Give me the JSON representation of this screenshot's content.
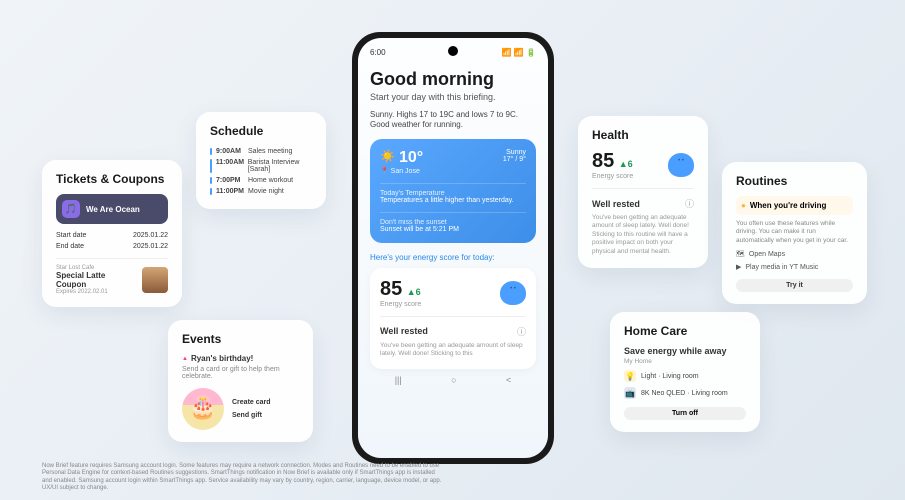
{
  "tickets": {
    "title": "Tickets & Coupons",
    "ticket_name": "We Are Ocean",
    "start_label": "Start date",
    "start_val": "2025.01.22",
    "end_label": "End date",
    "end_val": "2025.01.22",
    "coupon_vendor": "Star Lost Cafe",
    "coupon_name": "Special Latte Coupon",
    "coupon_exp": "Expires 2022.02.01"
  },
  "schedule": {
    "title": "Schedule",
    "items": [
      {
        "time": "9:00AM",
        "text": "Sales meeting"
      },
      {
        "time": "11:00AM",
        "text": "Barista Interview [Sarah]"
      },
      {
        "time": "7:00PM",
        "text": "Home workout"
      },
      {
        "time": "11:00PM",
        "text": "Movie night"
      }
    ]
  },
  "events": {
    "title": "Events",
    "headline": "Ryan's birthday!",
    "sub": "Send a card or gift to help them celebrate.",
    "btn1": "Create card",
    "btn2": "Send gift"
  },
  "phone": {
    "time": "6:00",
    "status_icons": "📶 📶 🔋",
    "greeting": "Good morning",
    "greeting_sub": "Start your day with this briefing.",
    "weather_summary": "Sunny. Highs 17 to 19C and lows 7 to 9C. Good weather for running.",
    "weather": {
      "temp": "10°",
      "loc": "📍 San Jose",
      "cond": "Sunny",
      "range": "17° / 9°",
      "sec1_h": "Today's Temperature",
      "sec1_v": "Temperatures a little higher than yesterday.",
      "sec2_h": "Don't miss the sunset",
      "sec2_v": "Sunset will be at 5:21 PM"
    },
    "energy_intro_a": "Here's your ",
    "energy_intro_b": "energy score",
    "energy_intro_c": " for today:",
    "energy": {
      "score": "85",
      "change": "▲6",
      "sub": "Energy score",
      "well": "Well rested",
      "info": "ⓘ",
      "desc": "You've been getting an adequate amount of sleep lately. Well done! Sticking to this"
    }
  },
  "health": {
    "title": "Health",
    "score": "85",
    "change": "▲6",
    "sub": "Energy score",
    "well": "Well rested",
    "info": "ⓘ",
    "desc": "You've been getting an adequate amount of sleep lately. Well done! Sticking to this routine will have a positive impact on both your physical and mental health."
  },
  "routines": {
    "title": "Routines",
    "head": "When you're driving",
    "desc": "You often use these features while driving. You can make it run automatically when you get in your car.",
    "item1": "Open Maps",
    "item2": "Play media in YT Music",
    "btn": "Try it"
  },
  "homecare": {
    "title": "Home Care",
    "headline": "Save energy while away",
    "sub": "My Home",
    "item1": "Light · Living room",
    "item2": "8K Neo QLED · Living room",
    "btn": "Turn off"
  },
  "footer": "Now Brief feature requires Samsung account login. Some features may require a network connection. Modes and Routines need to be enabled to use Personal Data Engine for context-based Routines suggestions. SmartThings notification in Now Brief is available only if SmartThings app is installed and enabled. Samsung account login within SmartThings app. Service availability may vary by country, region, carrier, language, device model, or app. UX/UI subject to change."
}
